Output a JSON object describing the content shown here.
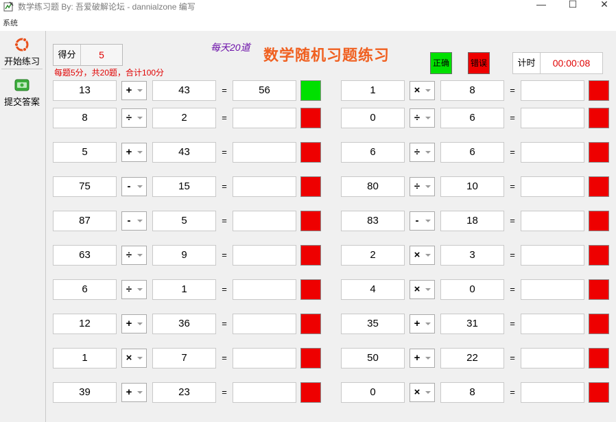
{
  "window": {
    "title": "数学练习题    By: 吾爱破解论坛 - dannialzone 编写",
    "minimize": "—",
    "maximize": "☐",
    "close": "✕"
  },
  "menu": {
    "system": "系统"
  },
  "toolbar": {
    "start_label": "开始练习",
    "start_icon": "ubuntu-logo-icon",
    "submit_label": "提交答案",
    "submit_icon": "money-icon"
  },
  "score": {
    "label": "得分",
    "value": "5"
  },
  "rules": "每题5分，共20题，合计100分",
  "daily": "每天20道",
  "heading": "数学随机习题练习",
  "legend": {
    "correct": "正确",
    "wrong": "错误",
    "correct_color": "#00e000",
    "wrong_color": "#ee0000"
  },
  "timer": {
    "label": "计时",
    "value": "00:00:08"
  },
  "problems_left": [
    {
      "a": "13",
      "op": "+",
      "b": "43",
      "eq": "=",
      "answer": "56",
      "status": "correct"
    },
    {
      "a": "8",
      "op": "÷",
      "b": "2",
      "eq": "=",
      "answer": "",
      "status": "wrong"
    },
    {
      "a": "5",
      "op": "+",
      "b": "43",
      "eq": "=",
      "answer": "",
      "status": "wrong"
    },
    {
      "a": "75",
      "op": "-",
      "b": "15",
      "eq": "=",
      "answer": "",
      "status": "wrong"
    },
    {
      "a": "87",
      "op": "-",
      "b": "5",
      "eq": "=",
      "answer": "",
      "status": "wrong"
    },
    {
      "a": "63",
      "op": "÷",
      "b": "9",
      "eq": "=",
      "answer": "",
      "status": "wrong"
    },
    {
      "a": "6",
      "op": "÷",
      "b": "1",
      "eq": "=",
      "answer": "",
      "status": "wrong"
    },
    {
      "a": "12",
      "op": "+",
      "b": "36",
      "eq": "=",
      "answer": "",
      "status": "wrong"
    },
    {
      "a": "1",
      "op": "×",
      "b": "7",
      "eq": "=",
      "answer": "",
      "status": "wrong"
    },
    {
      "a": "39",
      "op": "+",
      "b": "23",
      "eq": "=",
      "answer": "",
      "status": "wrong"
    }
  ],
  "problems_right": [
    {
      "a": "1",
      "op": "×",
      "b": "8",
      "eq": "=",
      "answer": "",
      "status": "wrong"
    },
    {
      "a": "0",
      "op": "÷",
      "b": "6",
      "eq": "=",
      "answer": "",
      "status": "wrong"
    },
    {
      "a": "6",
      "op": "÷",
      "b": "6",
      "eq": "=",
      "answer": "",
      "status": "wrong"
    },
    {
      "a": "80",
      "op": "÷",
      "b": "10",
      "eq": "=",
      "answer": "",
      "status": "wrong"
    },
    {
      "a": "83",
      "op": "-",
      "b": "18",
      "eq": "=",
      "answer": "",
      "status": "wrong"
    },
    {
      "a": "2",
      "op": "×",
      "b": "3",
      "eq": "=",
      "answer": "",
      "status": "wrong"
    },
    {
      "a": "4",
      "op": "×",
      "b": "0",
      "eq": "=",
      "answer": "",
      "status": "wrong"
    },
    {
      "a": "35",
      "op": "+",
      "b": "31",
      "eq": "=",
      "answer": "",
      "status": "wrong"
    },
    {
      "a": "50",
      "op": "+",
      "b": "22",
      "eq": "=",
      "answer": "",
      "status": "wrong"
    },
    {
      "a": "0",
      "op": "×",
      "b": "8",
      "eq": "=",
      "answer": "",
      "status": "wrong"
    }
  ]
}
